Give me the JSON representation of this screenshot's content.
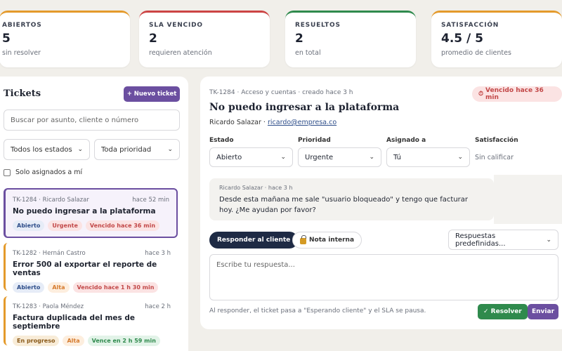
{
  "stats": [
    {
      "label": "ABIERTOS",
      "value": "5",
      "sub": "sin resolver",
      "color": "#e49a2b"
    },
    {
      "label": "SLA VENCIDO",
      "value": "2",
      "sub": "requieren atención",
      "color": "#cc4444"
    },
    {
      "label": "RESUELTOS",
      "value": "2",
      "sub": "en total",
      "color": "#2f8a4d"
    },
    {
      "label": "SATISFACCIÓN",
      "value": "4.5 / 5",
      "sub": "promedio de clientes",
      "color": "#e49a2b"
    }
  ],
  "sidebar": {
    "title": "Tickets",
    "new_button": "+ Nuevo ticket",
    "search_placeholder": "Buscar por asunto, cliente o número",
    "status_filter": "Todos los estados",
    "priority_filter": "Toda prioridad",
    "only_assigned": "Solo asignados a mí",
    "tickets": [
      {
        "id_client": "TK-1284 · Ricardo Salazar",
        "time": "hace 52 min",
        "subject": "No puedo ingresar a la plataforma",
        "badges": [
          "Abierto",
          "Urgente",
          "Vencido hace 36 min"
        ]
      },
      {
        "id_client": "TK-1282 · Hernán Castro",
        "time": "hace 3 h",
        "subject": "Error 500 al exportar el reporte de ventas",
        "badges": [
          "Abierto",
          "Alta",
          "Vencido hace 1 h 30 min"
        ]
      },
      {
        "id_client": "TK-1283 · Paola Méndez",
        "time": "hace 2 h",
        "subject": "Factura duplicada del mes de septiembre",
        "badges": [
          "En progreso",
          "Alta",
          "Vence en 2 h 59 min"
        ]
      }
    ]
  },
  "detail": {
    "meta": "TK-1284 · Acceso y cuentas · creado hace 3 h",
    "sla": "Vencido hace 36 min",
    "title": "No puedo ingresar a la plataforma",
    "client_name": "Ricardo Salazar · ",
    "client_email": "ricardo@empresa.co",
    "fields": {
      "status_label": "Estado",
      "status_value": "Abierto",
      "priority_label": "Prioridad",
      "priority_value": "Urgente",
      "assigned_label": "Asignado a",
      "assigned_value": "Tú",
      "satisfaction_label": "Satisfacción",
      "satisfaction_value": "Sin calificar"
    },
    "message": {
      "meta": "Ricardo Salazar · hace 3 h",
      "text": "Desde esta mañana me sale \"usuario bloqueado\" y tengo que facturar hoy. ¿Me ayudan por favor?"
    },
    "reply_button": "Responder al cliente",
    "note_button": "Nota interna",
    "canned": "Respuestas predefinidas...",
    "reply_placeholder": "Escribe tu respuesta...",
    "footer": "Al responder, el ticket pasa a \"Esperando cliente\" y el SLA se pausa.",
    "resolve_button": "✓ Resolver",
    "send_button": "Enviar"
  }
}
